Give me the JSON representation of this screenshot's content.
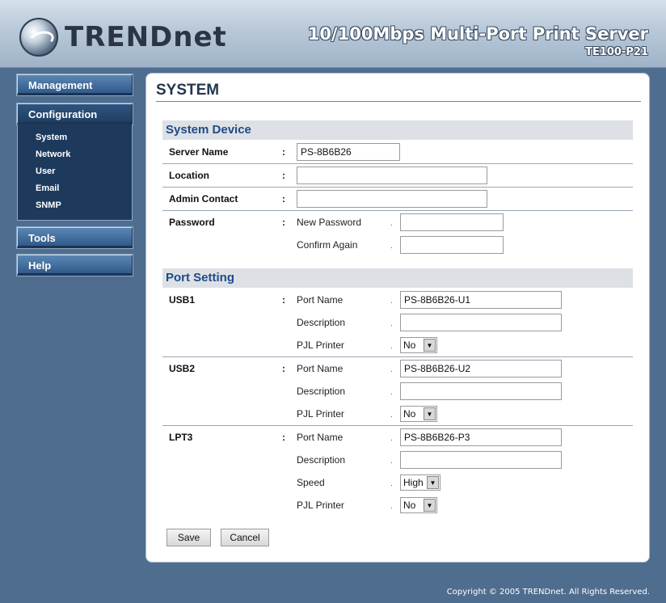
{
  "header": {
    "logo_text": "TRENDnet",
    "product_title": "10/100Mbps Multi-Port Print Server",
    "model": "TE100-P21"
  },
  "sidebar": {
    "management": "Management",
    "configuration": "Configuration",
    "sub_items": [
      "System",
      "Network",
      "User",
      "Email",
      "SNMP"
    ],
    "tools": "Tools",
    "help": "Help"
  },
  "page": {
    "title": "SYSTEM"
  },
  "system_device": {
    "heading": "System Device",
    "server_name_label": "Server Name",
    "server_name_value": "PS-8B6B26",
    "location_label": "Location",
    "location_value": "",
    "admin_contact_label": "Admin Contact",
    "admin_contact_value": "",
    "password_label": "Password",
    "new_password_label": "New Password",
    "confirm_label": "Confirm Again",
    "colon": ":",
    "dot": "."
  },
  "port_setting": {
    "heading": "Port Setting",
    "port_name_label": "Port Name",
    "description_label": "Description",
    "pjl_label": "PJL Printer",
    "speed_label": "Speed",
    "usb1": {
      "label": "USB1",
      "port_name": "PS-8B6B26-U1",
      "description": "",
      "pjl": "No"
    },
    "usb2": {
      "label": "USB2",
      "port_name": "PS-8B6B26-U2",
      "description": "",
      "pjl": "No"
    },
    "lpt3": {
      "label": "LPT3",
      "port_name": "PS-8B6B26-P3",
      "description": "",
      "speed": "High",
      "pjl": "No"
    }
  },
  "buttons": {
    "save": "Save",
    "cancel": "Cancel"
  },
  "footer": {
    "copyright": "Copyright © 2005 TRENDnet. All Rights Reserved."
  }
}
